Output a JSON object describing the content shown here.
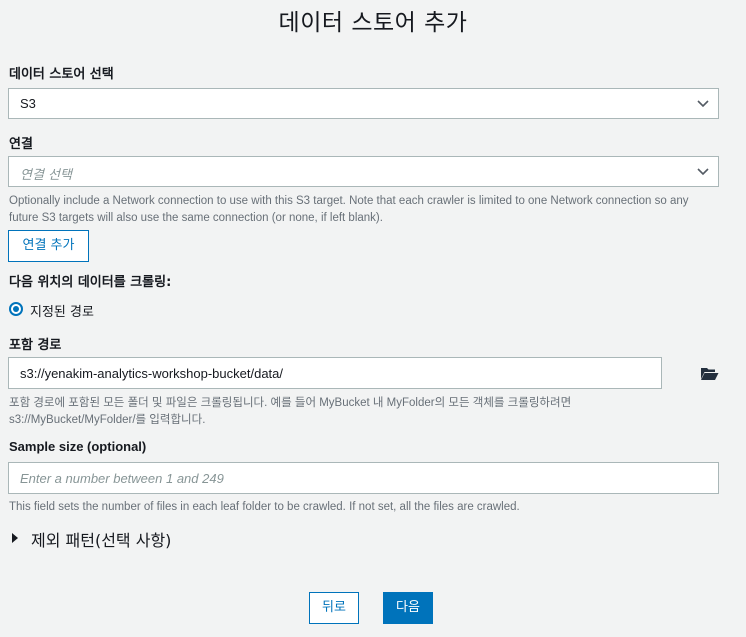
{
  "page": {
    "title": "데이터 스토어 추가"
  },
  "datastore": {
    "label": "데이터 스토어 선택",
    "value": "S3"
  },
  "connection": {
    "label": "연결",
    "placeholder": "연결 선택",
    "help_line1": "Optionally include a Network connection to use with this S3 target. Note that each crawler is limited to one Network connection so any",
    "help_line2": "future S3 targets will also use the same connection (or none, if left blank).",
    "add_button": "연결 추가"
  },
  "crawl": {
    "label": "다음 위치의 데이터를 크롤링:",
    "option_label": "지정된 경로",
    "option_selected": true
  },
  "include_path": {
    "label": "포함 경로",
    "value": "s3://yenakim-analytics-workshop-bucket/data/",
    "help_line1": "포함 경로에 포함된 모든 폴더 및 파일은 크롤링됩니다. 예를 들어 MyBucket 내 MyFolder의 모든 객체를 크롤링하려면",
    "help_line2": "s3://MyBucket/MyFolder/를 입력합니다."
  },
  "sample_size": {
    "label": "Sample size (optional)",
    "placeholder": "Enter a number between 1 and 249",
    "help": "This field sets the number of files in each leaf folder to be crawled. If not set, all the files are crawled."
  },
  "exclude": {
    "label": "제외 패턴(선택 사항)"
  },
  "footer": {
    "back": "뒤로",
    "next": "다음"
  },
  "colors": {
    "accent": "#0073bb",
    "border": "#aab7b8",
    "background": "#f2f3f3"
  }
}
